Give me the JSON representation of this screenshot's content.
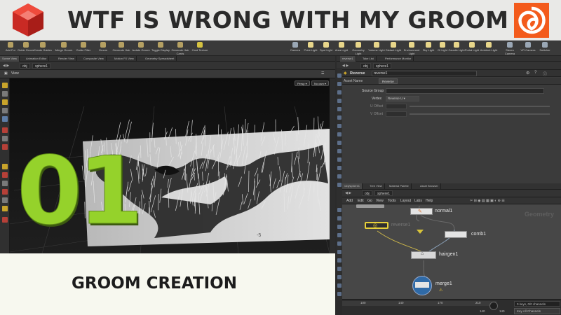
{
  "banner": {
    "title": "WTF IS WRONG WITH MY GROOM"
  },
  "logos": {
    "left": "redshift-logo",
    "right": "houdini-logo"
  },
  "colors": {
    "accent_green": "#95d22b",
    "banner_bg": "#e9e9e7",
    "houdini_orange": "#f35b1c",
    "redshift_red": "#e0322c",
    "node_yellow": "#d8c43a"
  },
  "caption": {
    "title": "GROOM CREATION"
  },
  "episode": {
    "number": "01"
  },
  "shelf": {
    "items": [
      "Add Fur",
      "Guide Groom",
      "Create Guides",
      "Merge Groom",
      "Guide Filter",
      "Groom",
      "Generate Hair",
      "Isolate Groom",
      "Toggle Display",
      "Generate Hair Cards",
      "Card Texture",
      "Camera",
      "Point Light",
      "Spot Light",
      "Area Light",
      "Geometry Light",
      "Volume Light",
      "Distant Light",
      "Environment Light",
      "Sky Light",
      "GI Light",
      "Caustic Light",
      "Portal Light",
      "Ambient Light",
      "Stereo Camera",
      "VR Camera",
      "Switcher"
    ]
  },
  "left_tabs": [
    "Scene View",
    "Animation Editor",
    "Render View",
    "Composite View",
    "Motion FX View",
    "Geometry Spreadsheet"
  ],
  "right_tabs": [
    "reverse1",
    "Take List",
    "Performance Monitor"
  ],
  "left_path": {
    "context": "obj",
    "node": "sphere1"
  },
  "viewport": {
    "label": "View",
    "persp": "Persp",
    "cam": "No cam"
  },
  "params": {
    "node_type": "Reverse",
    "node_name": "reverse1",
    "asset_name_label": "Asset Name",
    "asset_name_value": "Reverse",
    "rows": [
      {
        "label": "Source Group",
        "value": ""
      },
      {
        "label": "Vertex",
        "value": "Reverse U"
      },
      {
        "label": "U Offset",
        "value": ""
      },
      {
        "label": "V Offset",
        "value": ""
      }
    ]
  },
  "net_tabs": [
    "/obj/sphere1",
    "Tree View",
    "Material Palette",
    "Asset Browser"
  ],
  "net_path": {
    "context": "obj",
    "node": "sphere1"
  },
  "net_menu": [
    "Add",
    "Edit",
    "Go",
    "View",
    "Tools",
    "Layout",
    "Labs",
    "Help"
  ],
  "network": {
    "context_label": "Geometry",
    "nodes": [
      "normal1",
      "reverse1",
      "comb1",
      "hairgen1",
      "merge1"
    ]
  },
  "timeline": {
    "ticks": [
      "100",
      "140",
      "170",
      "210"
    ],
    "frame_start": "140",
    "frame_end": "140",
    "keys": "0 keys, 0/0 channels",
    "key_all": "Key All Channels"
  }
}
